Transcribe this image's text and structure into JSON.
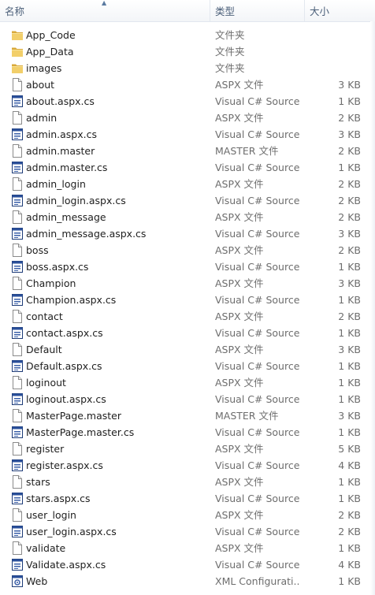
{
  "columns": {
    "name": "名称",
    "type": "类型",
    "size": "大小"
  },
  "files": [
    {
      "name": "App_Code",
      "type": "文件夹",
      "size": "",
      "icon": "folder-icon"
    },
    {
      "name": "App_Data",
      "type": "文件夹",
      "size": "",
      "icon": "folder-icon"
    },
    {
      "name": "images",
      "type": "文件夹",
      "size": "",
      "icon": "folder-icon"
    },
    {
      "name": "about",
      "type": "ASPX 文件",
      "size": "3 KB",
      "icon": "file-icon"
    },
    {
      "name": "about.aspx.cs",
      "type": "Visual C# Source...",
      "size": "1 KB",
      "icon": "csharp-file-icon"
    },
    {
      "name": "admin",
      "type": "ASPX 文件",
      "size": "2 KB",
      "icon": "file-icon"
    },
    {
      "name": "admin.aspx.cs",
      "type": "Visual C# Source...",
      "size": "3 KB",
      "icon": "csharp-file-icon"
    },
    {
      "name": "admin.master",
      "type": "MASTER 文件",
      "size": "2 KB",
      "icon": "file-icon"
    },
    {
      "name": "admin.master.cs",
      "type": "Visual C# Source...",
      "size": "1 KB",
      "icon": "csharp-file-icon"
    },
    {
      "name": "admin_login",
      "type": "ASPX 文件",
      "size": "2 KB",
      "icon": "file-icon"
    },
    {
      "name": "admin_login.aspx.cs",
      "type": "Visual C# Source...",
      "size": "2 KB",
      "icon": "csharp-file-icon"
    },
    {
      "name": "admin_message",
      "type": "ASPX 文件",
      "size": "2 KB",
      "icon": "file-icon"
    },
    {
      "name": "admin_message.aspx.cs",
      "type": "Visual C# Source...",
      "size": "3 KB",
      "icon": "csharp-file-icon"
    },
    {
      "name": "boss",
      "type": "ASPX 文件",
      "size": "2 KB",
      "icon": "file-icon"
    },
    {
      "name": "boss.aspx.cs",
      "type": "Visual C# Source...",
      "size": "1 KB",
      "icon": "csharp-file-icon"
    },
    {
      "name": "Champion",
      "type": "ASPX 文件",
      "size": "3 KB",
      "icon": "file-icon"
    },
    {
      "name": "Champion.aspx.cs",
      "type": "Visual C# Source...",
      "size": "1 KB",
      "icon": "csharp-file-icon"
    },
    {
      "name": "contact",
      "type": "ASPX 文件",
      "size": "2 KB",
      "icon": "file-icon"
    },
    {
      "name": "contact.aspx.cs",
      "type": "Visual C# Source...",
      "size": "1 KB",
      "icon": "csharp-file-icon"
    },
    {
      "name": "Default",
      "type": "ASPX 文件",
      "size": "3 KB",
      "icon": "file-icon"
    },
    {
      "name": "Default.aspx.cs",
      "type": "Visual C# Source...",
      "size": "1 KB",
      "icon": "csharp-file-icon"
    },
    {
      "name": "loginout",
      "type": "ASPX 文件",
      "size": "1 KB",
      "icon": "file-icon"
    },
    {
      "name": "loginout.aspx.cs",
      "type": "Visual C# Source...",
      "size": "1 KB",
      "icon": "csharp-file-icon"
    },
    {
      "name": "MasterPage.master",
      "type": "MASTER 文件",
      "size": "3 KB",
      "icon": "file-icon"
    },
    {
      "name": "MasterPage.master.cs",
      "type": "Visual C# Source...",
      "size": "1 KB",
      "icon": "csharp-file-icon"
    },
    {
      "name": "register",
      "type": "ASPX 文件",
      "size": "5 KB",
      "icon": "file-icon"
    },
    {
      "name": "register.aspx.cs",
      "type": "Visual C# Source...",
      "size": "4 KB",
      "icon": "csharp-file-icon"
    },
    {
      "name": "stars",
      "type": "ASPX 文件",
      "size": "1 KB",
      "icon": "file-icon"
    },
    {
      "name": "stars.aspx.cs",
      "type": "Visual C# Source...",
      "size": "1 KB",
      "icon": "csharp-file-icon"
    },
    {
      "name": "user_login",
      "type": "ASPX 文件",
      "size": "2 KB",
      "icon": "file-icon"
    },
    {
      "name": "user_login.aspx.cs",
      "type": "Visual C# Source...",
      "size": "2 KB",
      "icon": "csharp-file-icon"
    },
    {
      "name": "validate",
      "type": "ASPX 文件",
      "size": "1 KB",
      "icon": "file-icon"
    },
    {
      "name": "Validate.aspx.cs",
      "type": "Visual C# Source...",
      "size": "4 KB",
      "icon": "csharp-file-icon"
    },
    {
      "name": "Web",
      "type": "XML Configurati...",
      "size": "1 KB",
      "icon": "config-file-icon"
    }
  ],
  "colors": {
    "header_text": "#4c607a",
    "name_text": "#1e1e1e",
    "meta_text": "#6d6d6d",
    "folder": "#e8c25a"
  }
}
